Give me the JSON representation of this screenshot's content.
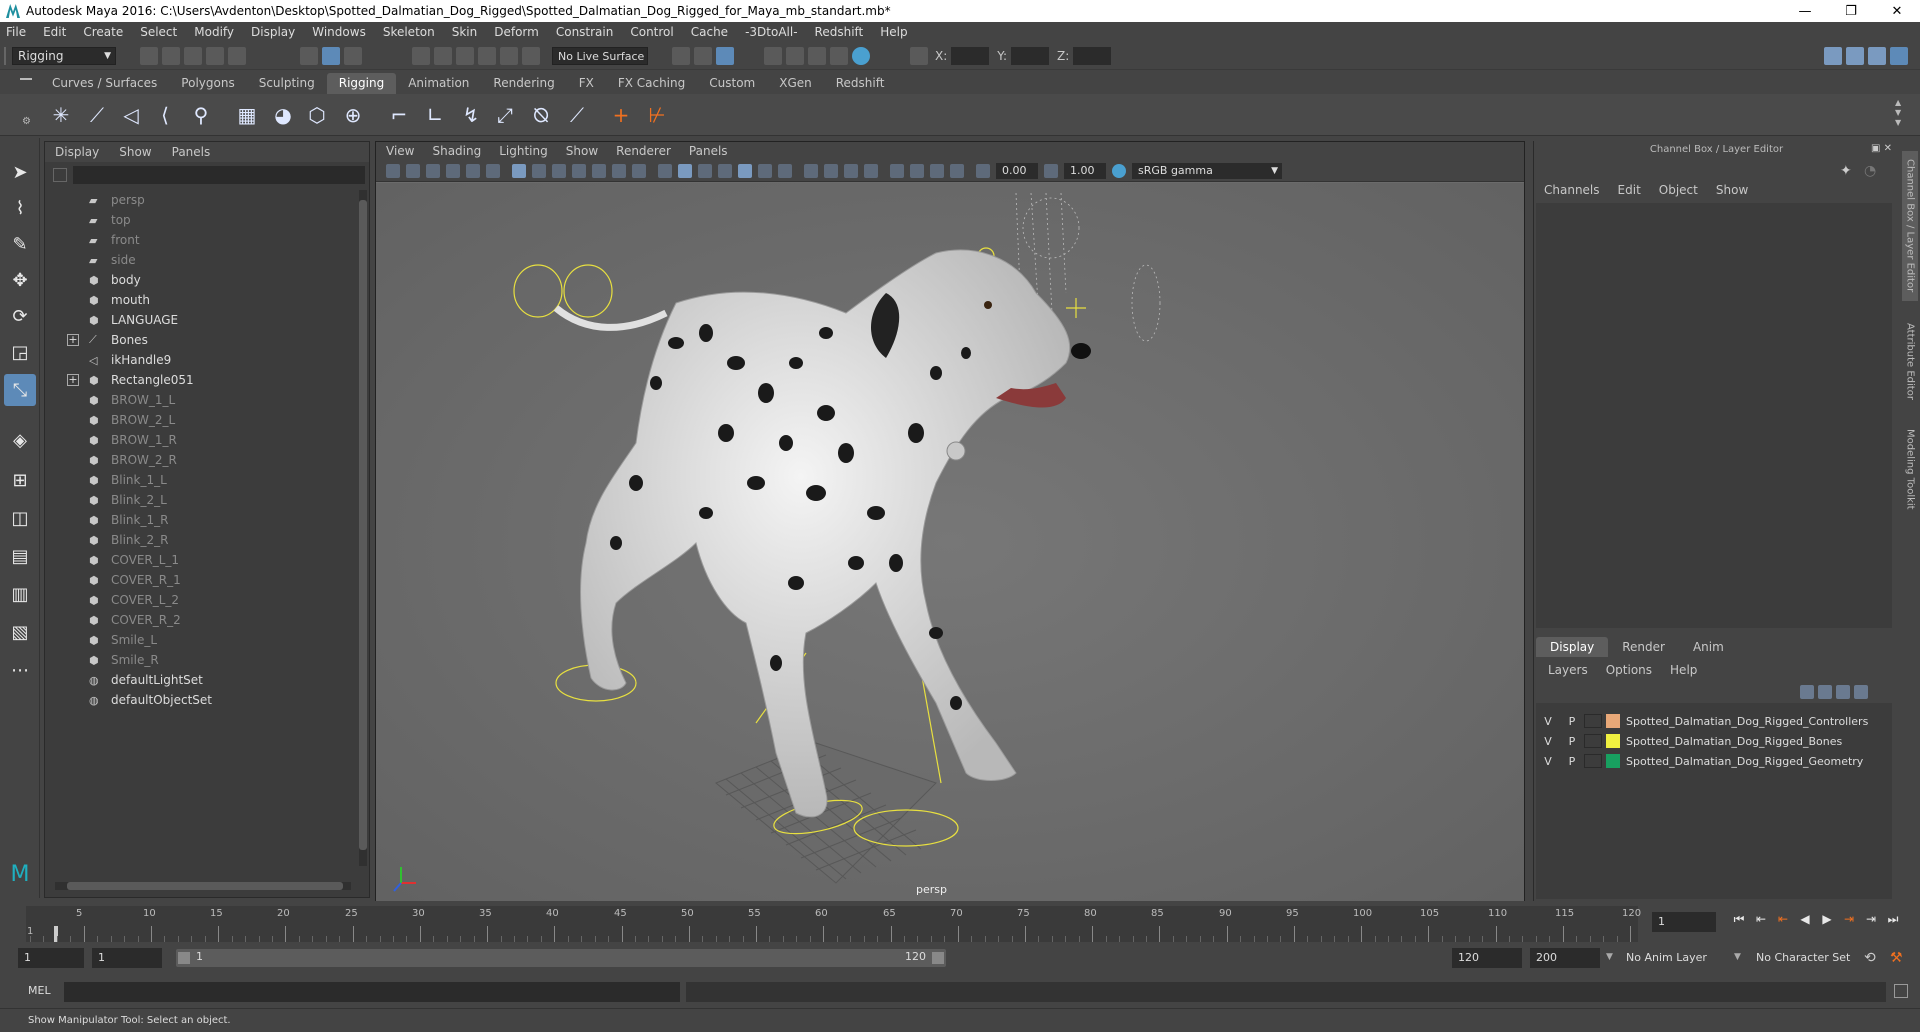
{
  "window": {
    "title": "Autodesk Maya 2016: C:\\Users\\Avdenton\\Desktop\\Spotted_Dalmatian_Dog_Rigged\\Spotted_Dalmatian_Dog_Rigged_for_Maya_mb_standart.mb*",
    "controls": [
      "—",
      "❐",
      "✕"
    ]
  },
  "menubar": [
    "File",
    "Edit",
    "Create",
    "Select",
    "Modify",
    "Display",
    "Windows",
    "Skeleton",
    "Skin",
    "Deform",
    "Constrain",
    "Control",
    "Cache",
    "-3DtoAll-",
    "Redshift",
    "Help"
  ],
  "statusline": {
    "mode": "Rigging",
    "live_surface": "No Live Surface",
    "x_label": "X:",
    "y_label": "Y:",
    "z_label": "Z:"
  },
  "shelf_tabs": [
    "Curves / Surfaces",
    "Polygons",
    "Sculpting",
    "Rigging",
    "Animation",
    "Rendering",
    "FX",
    "FX Caching",
    "Custom",
    "XGen",
    "Redshift"
  ],
  "active_shelf_tab": "Rigging",
  "outliner": {
    "menu": [
      "Display",
      "Show",
      "Panels"
    ],
    "items": [
      {
        "label": "persp",
        "icon": "camera-icon",
        "dim": true
      },
      {
        "label": "top",
        "icon": "camera-icon",
        "dim": true
      },
      {
        "label": "front",
        "icon": "camera-icon",
        "dim": true
      },
      {
        "label": "side",
        "icon": "camera-icon",
        "dim": true
      },
      {
        "label": "body",
        "icon": "mesh-icon",
        "dim": false
      },
      {
        "label": "mouth",
        "icon": "mesh-icon",
        "dim": false
      },
      {
        "label": "LANGUAGE",
        "icon": "mesh-icon",
        "dim": false
      },
      {
        "label": "Bones",
        "icon": "joint-icon",
        "dim": false,
        "expand": true
      },
      {
        "label": "ikHandle9",
        "icon": "ikhandle-icon",
        "dim": false
      },
      {
        "label": "Rectangle051",
        "icon": "mesh-icon",
        "dim": false,
        "expand": true
      },
      {
        "label": "BROW_1_L",
        "icon": "mesh-icon",
        "dim": true
      },
      {
        "label": "BROW_2_L",
        "icon": "mesh-icon",
        "dim": true
      },
      {
        "label": "BROW_1_R",
        "icon": "mesh-icon",
        "dim": true
      },
      {
        "label": "BROW_2_R",
        "icon": "mesh-icon",
        "dim": true
      },
      {
        "label": "Blink_1_L",
        "icon": "mesh-icon",
        "dim": true
      },
      {
        "label": "Blink_2_L",
        "icon": "mesh-icon",
        "dim": true
      },
      {
        "label": "Blink_1_R",
        "icon": "mesh-icon",
        "dim": true
      },
      {
        "label": "Blink_2_R",
        "icon": "mesh-icon",
        "dim": true
      },
      {
        "label": "COVER_L_1",
        "icon": "mesh-icon",
        "dim": true
      },
      {
        "label": "COVER_R_1",
        "icon": "mesh-icon",
        "dim": true
      },
      {
        "label": "COVER_L_2",
        "icon": "mesh-icon",
        "dim": true
      },
      {
        "label": "COVER_R_2",
        "icon": "mesh-icon",
        "dim": true
      },
      {
        "label": "Smile_L",
        "icon": "mesh-icon",
        "dim": true
      },
      {
        "label": "Smile_R",
        "icon": "mesh-icon",
        "dim": true
      },
      {
        "label": "defaultLightSet",
        "icon": "set-icon",
        "dim": false
      },
      {
        "label": "defaultObjectSet",
        "icon": "set-icon",
        "dim": false
      }
    ]
  },
  "viewport": {
    "menu": [
      "View",
      "Shading",
      "Lighting",
      "Show",
      "Renderer",
      "Panels"
    ],
    "exposure": "0.00",
    "gamma": "1.00",
    "color_space": "sRGB gamma",
    "camera": "persp"
  },
  "channel_box": {
    "title": "Channel Box / Layer Editor",
    "menu": [
      "Channels",
      "Edit",
      "Object",
      "Show"
    ]
  },
  "layer_editor": {
    "tabs": [
      "Display",
      "Render",
      "Anim"
    ],
    "active_tab": "Display",
    "menu": [
      "Layers",
      "Options",
      "Help"
    ],
    "layers": [
      {
        "v": "V",
        "p": "P",
        "name": "Spotted_Dalmatian_Dog_Rigged_Controllers",
        "color": "#e8a878"
      },
      {
        "v": "V",
        "p": "P",
        "name": "Spotted_Dalmatian_Dog_Rigged_Bones",
        "color": "#f0f040"
      },
      {
        "v": "V",
        "p": "P",
        "name": "Spotted_Dalmatian_Dog_Rigged_Geometry",
        "color": "#18a060"
      }
    ]
  },
  "side_tabs": [
    "Channel Box / Layer Editor",
    "Attribute Editor",
    "Modeling Toolkit"
  ],
  "timeline": {
    "ticks": [
      "5",
      "10",
      "15",
      "20",
      "25",
      "30",
      "35",
      "40",
      "45",
      "50",
      "55",
      "60",
      "65",
      "70",
      "75",
      "80",
      "85",
      "90",
      "95",
      "100",
      "105",
      "110",
      "115",
      "120"
    ],
    "start_tick": "1",
    "current_frame": "1"
  },
  "range": {
    "start": "1",
    "playback_start": "1",
    "slider_start": "1",
    "slider_end": "120",
    "playback_end": "120",
    "end": "200",
    "anim_layer": "No Anim Layer",
    "character_set": "No Character Set"
  },
  "command_line": {
    "lang": "MEL"
  },
  "help_line": "Show Manipulator Tool: Select an object.",
  "colors": {
    "accent": "#5d8ab8",
    "rig_yellow": "#e8e040"
  }
}
